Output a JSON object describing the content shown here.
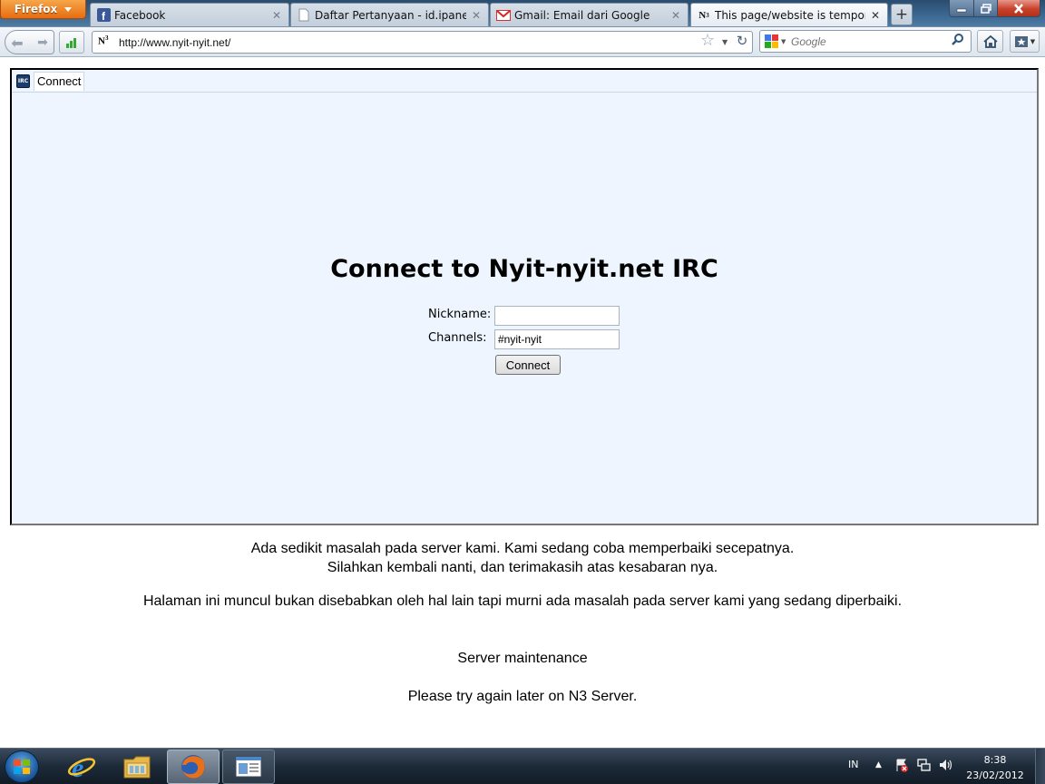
{
  "browser": {
    "menu_button": "Firefox",
    "tabs": [
      {
        "label": "Facebook",
        "icon": "facebook-icon"
      },
      {
        "label": "Daftar Pertanyaan - id.ipanelonl...",
        "icon": "page-icon"
      },
      {
        "label": "Gmail: Email dari Google",
        "icon": "gmail-icon"
      },
      {
        "label": "This page/website is temporaril...",
        "icon": "n3-icon",
        "active": true
      }
    ],
    "new_tab": "+",
    "url": "http://www.nyit-nyit.net/",
    "url_favicon": "N³",
    "search_placeholder": "Google"
  },
  "irc": {
    "tab_label": "Connect",
    "logo": "IRC",
    "title": "Connect to Nyit-nyit.net IRC",
    "nickname_label": "Nickname:",
    "nickname_value": "",
    "channels_label": "Channels:",
    "channels_value": "#nyit-nyit",
    "connect_button": "Connect"
  },
  "messages": {
    "line1": "Ada sedikit masalah pada server kami. Kami sedang coba memperbaiki secepatnya.",
    "line2": "Silahkan kembali nanti, dan terimakasih atas kesabaran nya.",
    "line3": "Halaman ini muncul bukan disebabkan oleh hal lain tapi murni ada masalah pada server kami yang sedang diperbaiki.",
    "line4": "Server maintenance",
    "line5": "Please try again later on N3 Server."
  },
  "taskbar": {
    "language": "IN",
    "time": "8:38",
    "date": "23/02/2012"
  },
  "colors": {
    "irc_background": "#eef5fe",
    "firefox_orange": "#e66d10",
    "close_red": "#c8412b"
  }
}
